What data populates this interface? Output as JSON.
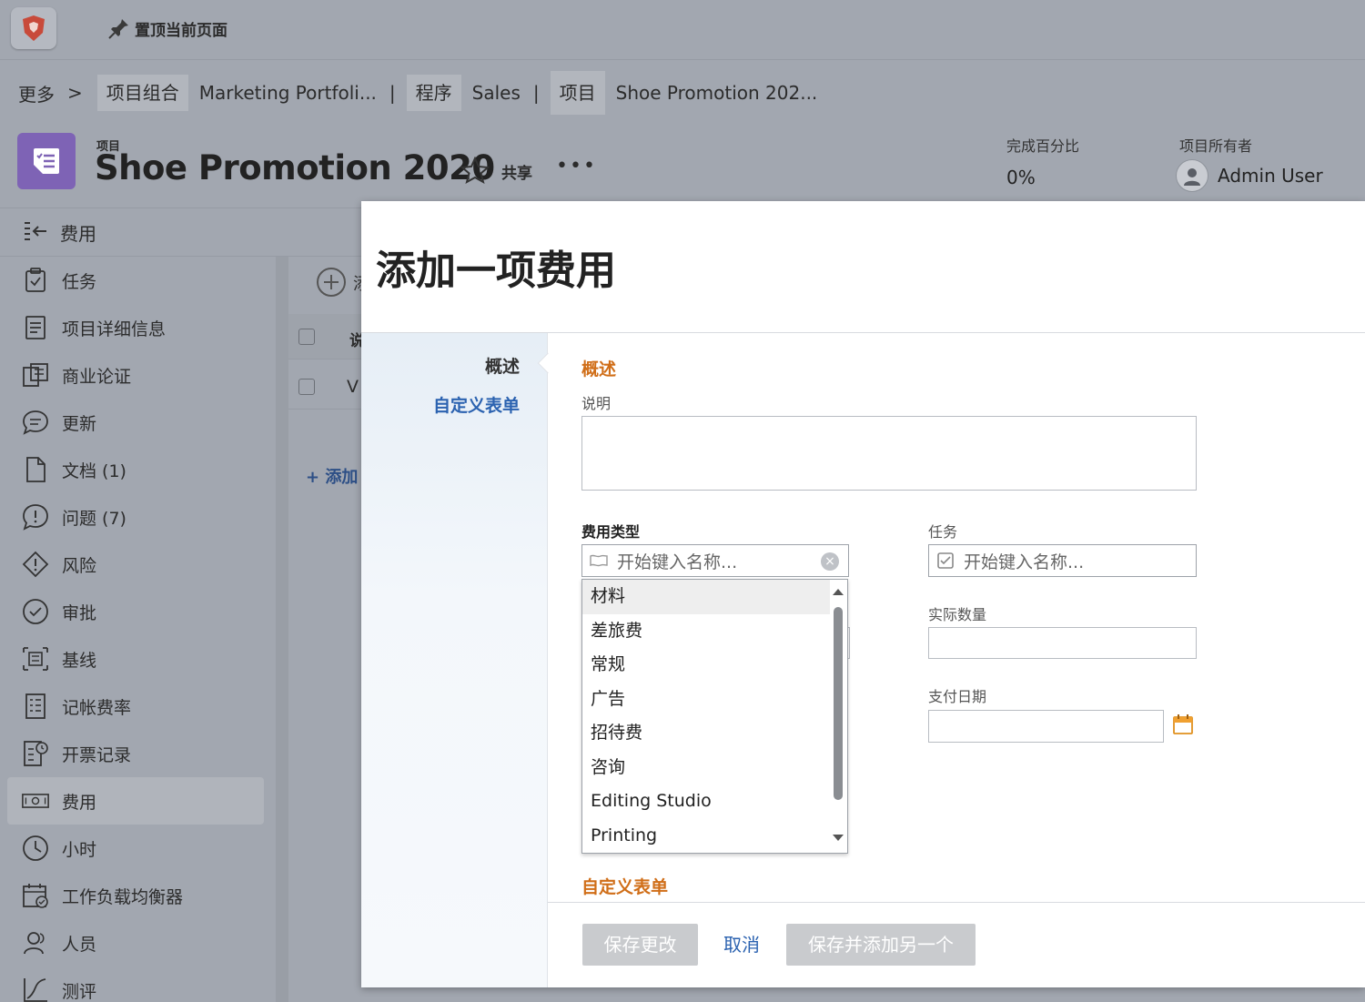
{
  "topbar": {
    "pin_label": "置顶当前页面"
  },
  "breadcrumb": {
    "more": "更多",
    "more_sep": ">",
    "portfolio_type": "项目组合",
    "portfolio_name": "Marketing Portfoli...",
    "program_type": "程序",
    "program_name": "Sales",
    "project_type": "项目",
    "project_name": "Shoe Promotion 202...",
    "sep": "|"
  },
  "project": {
    "kicker": "项目",
    "title": "Shoe Promotion 2020",
    "share_label": "共享",
    "more_label": "•••",
    "percent_label": "完成百分比",
    "percent_value": "0%",
    "owner_label": "项目所有者",
    "owner_name": "Admin User"
  },
  "sidebar": {
    "header": "费用",
    "items": [
      {
        "label": "任务",
        "icon": "clipboard-check-icon"
      },
      {
        "label": "项目详细信息",
        "icon": "document-lines-icon"
      },
      {
        "label": "商业论证",
        "icon": "business-case-icon"
      },
      {
        "label": "更新",
        "icon": "chat-bubble-icon"
      },
      {
        "label": "文档 (1)",
        "icon": "file-icon"
      },
      {
        "label": "问题 (7)",
        "icon": "issue-bubble-icon"
      },
      {
        "label": "风险",
        "icon": "risk-diamond-icon"
      },
      {
        "label": "审批",
        "icon": "approval-check-icon"
      },
      {
        "label": "基线",
        "icon": "baseline-icon"
      },
      {
        "label": "记帐费率",
        "icon": "billing-rate-icon"
      },
      {
        "label": "开票记录",
        "icon": "invoice-icon"
      },
      {
        "label": "费用",
        "icon": "money-icon"
      },
      {
        "label": "小时",
        "icon": "clock-icon"
      },
      {
        "label": "工作负载均衡器",
        "icon": "calendar-check-icon"
      },
      {
        "label": "人员",
        "icon": "people-icon"
      },
      {
        "label": "测评",
        "icon": "chart-line-icon"
      }
    ]
  },
  "background": {
    "col_header_partial": "说",
    "row_partial": "V",
    "add_link": "+ 添加"
  },
  "modal": {
    "title": "添加一项费用",
    "side_links": [
      "概述",
      "自定义表单"
    ],
    "section_overview": "概述",
    "description_label": "说明",
    "expense_type_label": "费用类型",
    "expense_type_placeholder": "开始键入名称...",
    "task_label": "任务",
    "task_placeholder": "开始键入名称...",
    "actual_qty_label": "实际数量",
    "pay_date_label": "支付日期",
    "expense_options": [
      "材料",
      "差旅费",
      "常规",
      "广告",
      "招待费",
      "咨询",
      "Editing Studio",
      "Printing"
    ],
    "section_custom": "自定义表单",
    "btn_save": "保存更改",
    "btn_cancel": "取消",
    "btn_save_add": "保存并添加另一个"
  },
  "colors": {
    "accent_orange": "#d06e18",
    "link_blue": "#2b62b0",
    "project_purple": "#7e63b5",
    "overlay_gray": "#a2a7b0"
  }
}
